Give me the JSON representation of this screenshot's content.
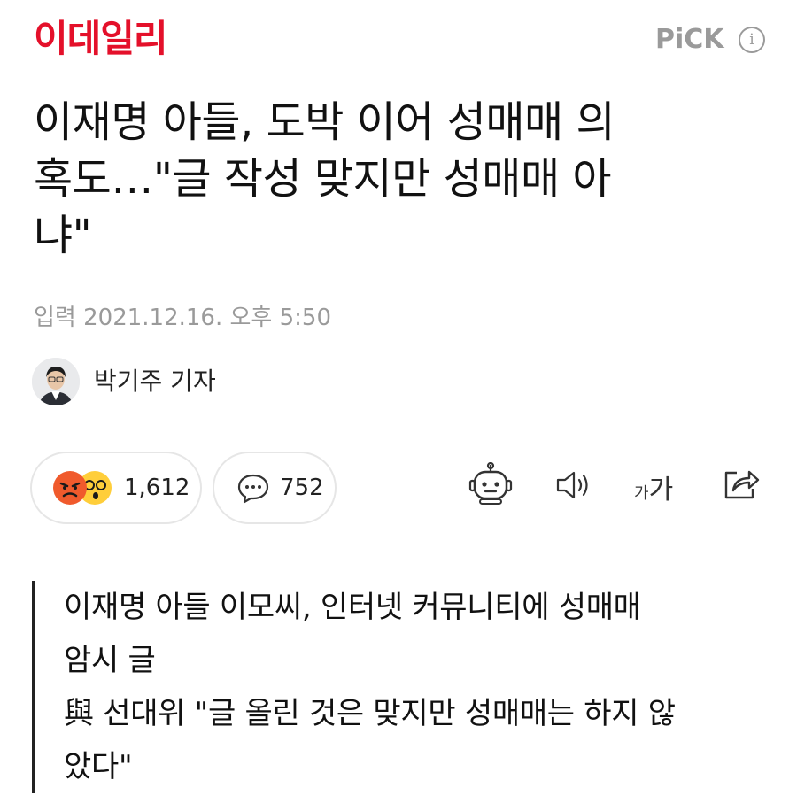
{
  "header": {
    "logo_text": "이데일리",
    "pick_label": "PiCK",
    "info_icon": "info-icon",
    "brand_color": "#e4102a"
  },
  "article": {
    "headline_lines": [
      "이재명 아들, 도박 이어 성매매 의",
      "혹도…\"글 작성 맞지만 성매매 아",
      "냐\""
    ],
    "published": "입력 2021.12.16. 오후 5:50",
    "reporter": "박기주 기자"
  },
  "actions": {
    "reactions": {
      "icons": [
        "angry-emoji-icon",
        "wow-emoji-icon"
      ],
      "count": "1,612"
    },
    "comments": {
      "icon": "comment-bubble-icon",
      "count": "752"
    },
    "tools": [
      "robot-summary-icon",
      "speaker-icon",
      "font-size-icon",
      "share-icon"
    ],
    "font_size_small": "가",
    "font_size_big": "가"
  },
  "summary": {
    "lines": [
      "이재명 아들 이모씨, 인터넷 커뮤니티에 성매매",
      "암시 글",
      "與 선대위 \"글 올린 것은 맞지만 성매매는 하지 않",
      "았다\""
    ]
  }
}
